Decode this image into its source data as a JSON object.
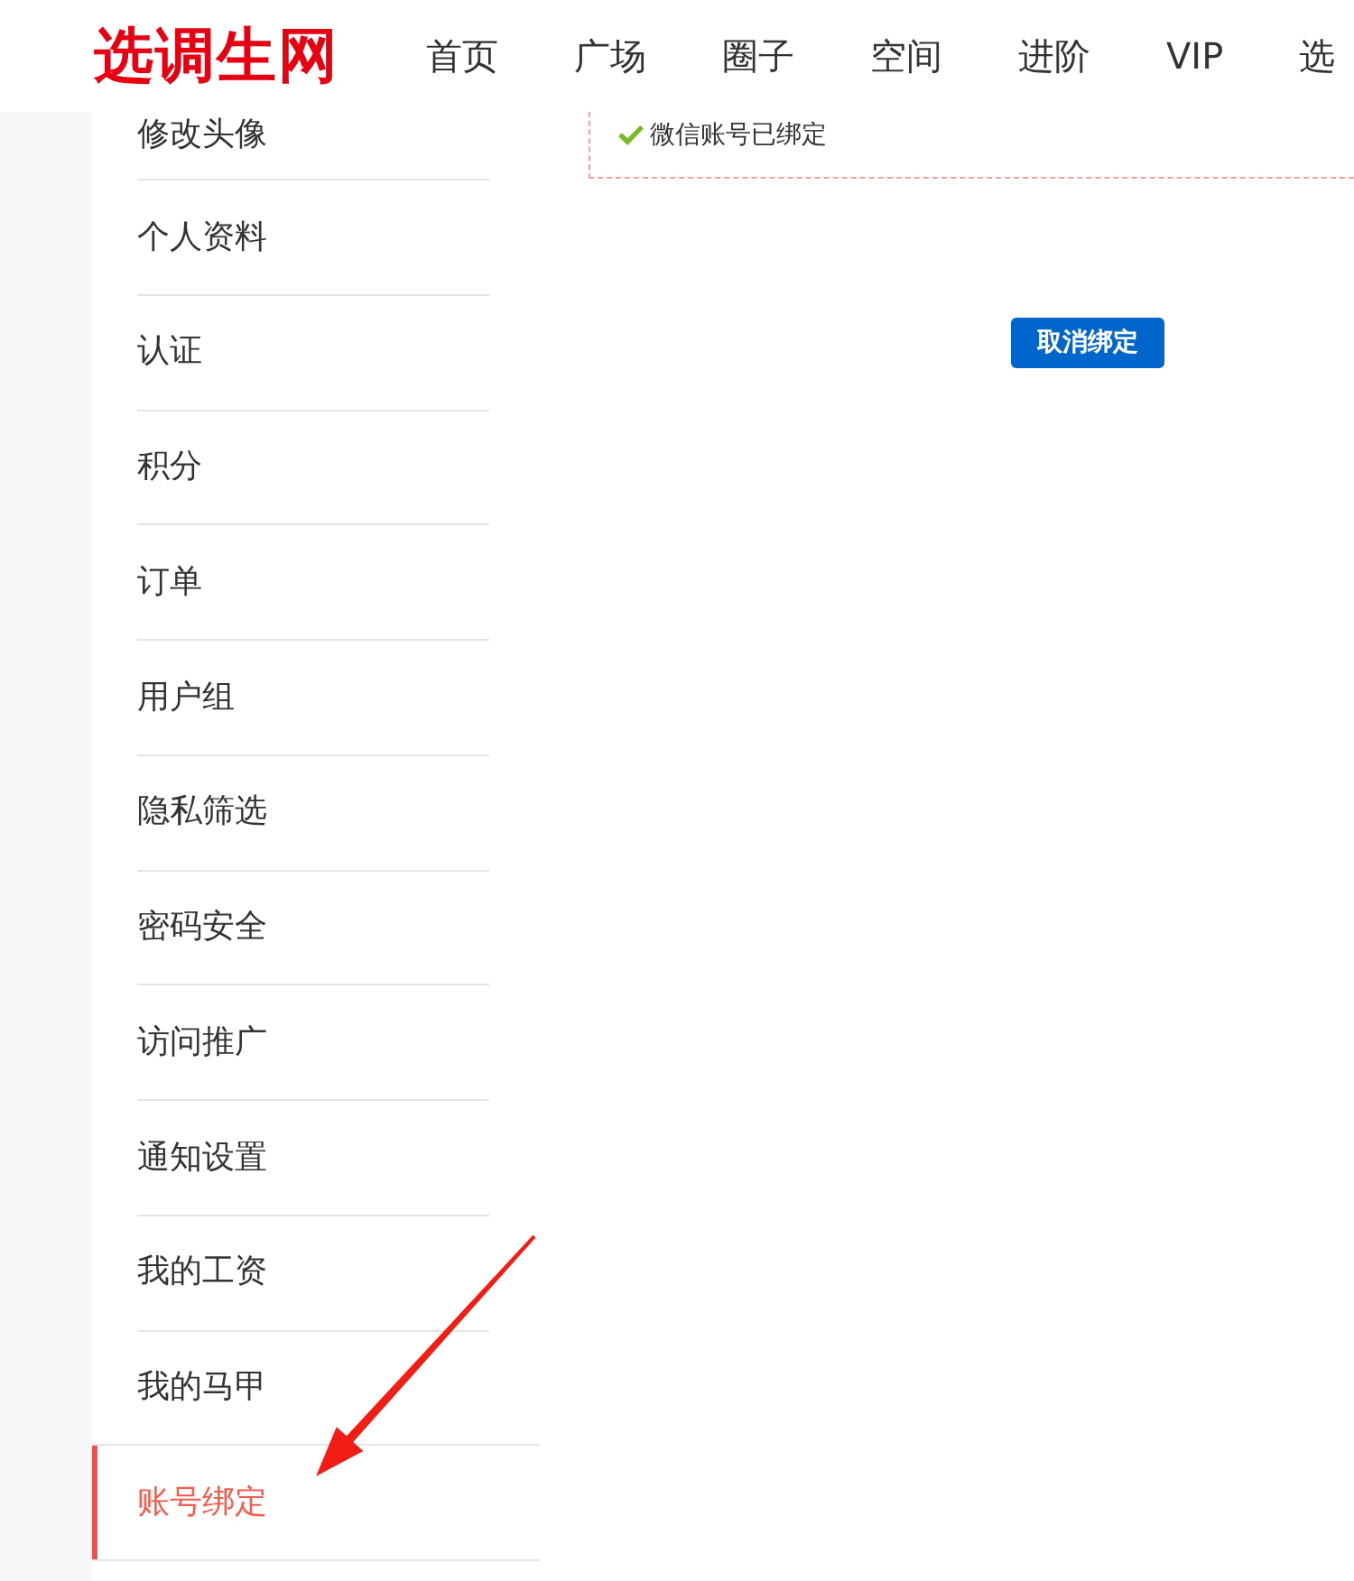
{
  "header": {
    "logo": "选调生网",
    "nav": [
      "首页",
      "广场",
      "圈子",
      "空间",
      "进阶",
      "VIP",
      "选"
    ]
  },
  "sidebar": {
    "items": [
      {
        "label": "修改头像",
        "selected": false
      },
      {
        "label": "个人资料",
        "selected": false
      },
      {
        "label": "认证",
        "selected": false
      },
      {
        "label": "积分",
        "selected": false
      },
      {
        "label": "订单",
        "selected": false
      },
      {
        "label": "用户组",
        "selected": false
      },
      {
        "label": "隐私筛选",
        "selected": false
      },
      {
        "label": "密码安全",
        "selected": false
      },
      {
        "label": "访问推广",
        "selected": false
      },
      {
        "label": "通知设置",
        "selected": false
      },
      {
        "label": "我的工资",
        "selected": false
      },
      {
        "label": "我的马甲",
        "selected": false
      },
      {
        "label": "账号绑定",
        "selected": true
      }
    ]
  },
  "binding": {
    "bound": true,
    "status": "微信账号已绑定",
    "button": "取消绑定"
  }
}
